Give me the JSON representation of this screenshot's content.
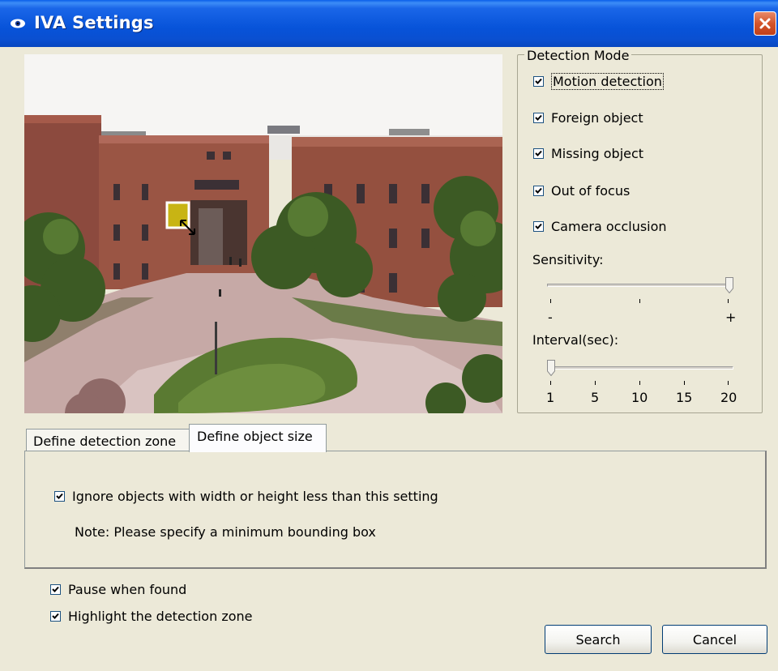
{
  "window": {
    "title": "IVA Settings"
  },
  "icons": {
    "title": "eye-icon",
    "close": "close-icon"
  },
  "detection_mode": {
    "legend": "Detection Mode",
    "options": [
      {
        "label": "Motion detection",
        "checked": true
      },
      {
        "label": "Foreign object",
        "checked": true
      },
      {
        "label": "Missing object",
        "checked": true
      },
      {
        "label": "Out of focus",
        "checked": true
      },
      {
        "label": "Camera occlusion",
        "checked": true
      }
    ],
    "sensitivity": {
      "label": "Sensitivity:",
      "min_label": "-",
      "max_label": "+",
      "value_fraction": 1.0
    },
    "interval": {
      "label": "Interval(sec):",
      "ticks": [
        "1",
        "5",
        "10",
        "15",
        "20"
      ],
      "value": 1
    }
  },
  "tabs": [
    {
      "label": "Define detection zone",
      "active": false
    },
    {
      "label": "Define object size",
      "active": true
    }
  ],
  "object_size": {
    "ignore_label": "Ignore objects with width or height less than this setting",
    "ignore_checked": true,
    "note": "Note: Please specify a minimum bounding box"
  },
  "options": {
    "pause_label": "Pause when found",
    "pause_checked": true,
    "highlight_label": "Highlight the detection zone",
    "highlight_checked": true
  },
  "buttons": {
    "search": "Search",
    "cancel": "Cancel"
  },
  "colors": {
    "titlebar": "#0753d9",
    "window_bg": "#ece9d8",
    "box_marker": "#c8b414"
  }
}
